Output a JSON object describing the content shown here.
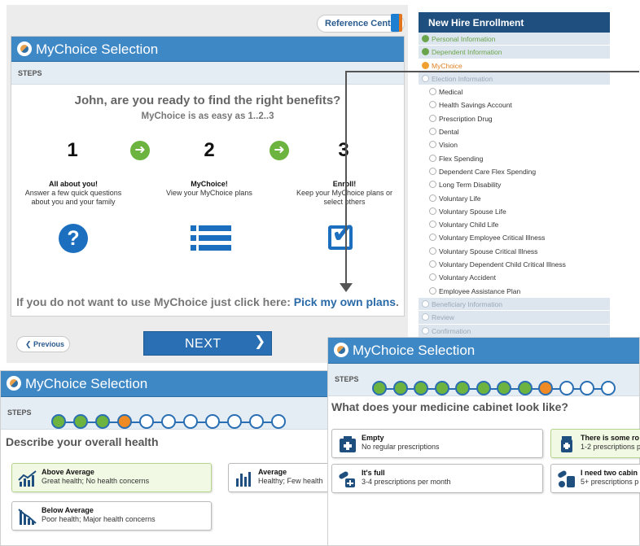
{
  "reference": {
    "label": "Reference Center"
  },
  "panel_a": {
    "title": "MyChoice Selection",
    "steps_label": "STEPS",
    "question": "John, are you ready to find the right benefits?",
    "subtitle": "MyChoice is as easy as 1..2..3",
    "steps": [
      {
        "num": "1",
        "title": "All about you!",
        "text": "Answer a few quick questions about you and your family"
      },
      {
        "num": "2",
        "title": "MyChoice!",
        "text": "View your MyChoice plans"
      },
      {
        "num": "3",
        "title": "Enroll!",
        "text": "Keep your MyChoice plans or select others"
      }
    ],
    "footer_text": "If you do not want to use MyChoice just click here:",
    "footer_link": "Pick my own plans",
    "footer_end": ".",
    "prev_label": "Previous",
    "next_label": "NEXT"
  },
  "sidebar": {
    "title": "New Hire Enrollment",
    "items": [
      {
        "label": "Personal Information",
        "state": "done"
      },
      {
        "label": "Dependent Information",
        "state": "done"
      },
      {
        "label": "MyChoice",
        "state": "current"
      },
      {
        "label": "Election Information",
        "state": "section"
      },
      {
        "label": "Medical",
        "state": "sub"
      },
      {
        "label": "Health Savings Account",
        "state": "sub"
      },
      {
        "label": "Prescription Drug",
        "state": "sub"
      },
      {
        "label": "Dental",
        "state": "sub"
      },
      {
        "label": "Vision",
        "state": "sub"
      },
      {
        "label": "Flex Spending",
        "state": "sub"
      },
      {
        "label": "Dependent Care Flex Spending",
        "state": "sub"
      },
      {
        "label": "Long Term Disability",
        "state": "sub"
      },
      {
        "label": "Voluntary Life",
        "state": "sub"
      },
      {
        "label": "Voluntary Spouse Life",
        "state": "sub"
      },
      {
        "label": "Voluntary Child Life",
        "state": "sub"
      },
      {
        "label": "Voluntary Employee Critical Illness",
        "state": "sub"
      },
      {
        "label": "Voluntary Spouse Critical Illness",
        "state": "sub"
      },
      {
        "label": "Voluntary Dependent Child Critical Illness",
        "state": "sub"
      },
      {
        "label": "Voluntary Accident",
        "state": "sub"
      },
      {
        "label": "Employee Assistance Plan",
        "state": "sub"
      },
      {
        "label": "Beneficiary Information",
        "state": "section"
      },
      {
        "label": "Review",
        "state": "section"
      },
      {
        "label": "Confirmation",
        "state": "section"
      }
    ]
  },
  "panel_b": {
    "title": "MyChoice Selection",
    "steps_label": "STEPS",
    "question": "Describe your overall health",
    "options": [
      {
        "title": "Above Average",
        "text": "Great health; No health concerns",
        "selected": true
      },
      {
        "title": "Average",
        "text": "Healthy; Few health",
        "selected": false
      },
      {
        "title": "Below Average",
        "text": "Poor health; Major health concerns",
        "selected": false
      }
    ]
  },
  "panel_c": {
    "title": "MyChoice Selection",
    "steps_label": "STEPS",
    "question": "What does your medicine cabinet look like?",
    "options": [
      {
        "title": "Empty",
        "text": "No regular prescriptions",
        "selected": false
      },
      {
        "title": "There is some ro",
        "text": "1-2 prescriptions p",
        "selected": true
      },
      {
        "title": "It's full",
        "text": "3-4 prescriptions per month",
        "selected": false
      },
      {
        "title": "I need two cabin",
        "text": "5+ prescriptions p",
        "selected": false
      }
    ]
  },
  "colors": {
    "brand_blue": "#3f88c6",
    "done_green": "#6cb33f",
    "current_orange": "#f08a24"
  }
}
